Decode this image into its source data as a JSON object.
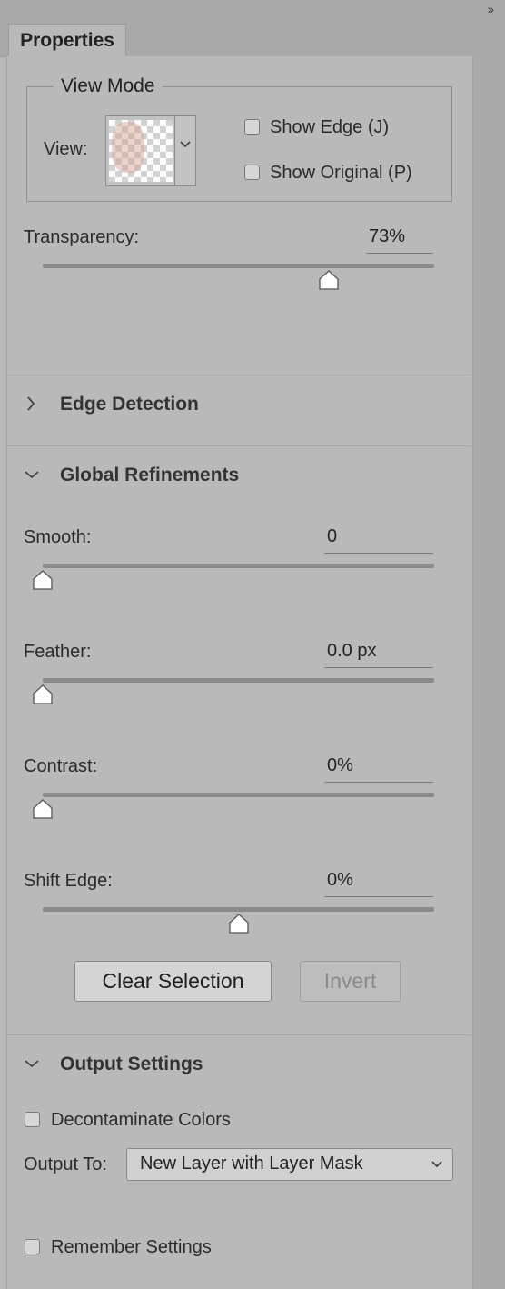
{
  "panel": {
    "collapse_icon": "double-chevron-right-icon",
    "tab_label": "Properties"
  },
  "view_mode": {
    "legend": "View Mode",
    "view_label": "View:",
    "show_edge_label": "Show Edge (J)",
    "show_edge_checked": false,
    "show_original_label": "Show Original (P)",
    "show_original_checked": false
  },
  "transparency": {
    "label": "Transparency:",
    "value": "73%",
    "level": 0.73
  },
  "edge_detection": {
    "title": "Edge Detection",
    "expanded": false
  },
  "global_refinements": {
    "title": "Global Refinements",
    "expanded": true,
    "smooth": {
      "label": "Smooth:",
      "value": "0",
      "level": 0
    },
    "feather": {
      "label": "Feather:",
      "value": "0.0 px",
      "level": 0
    },
    "contrast": {
      "label": "Contrast:",
      "value": "0%",
      "level": 0
    },
    "shift_edge": {
      "label": "Shift Edge:",
      "value": "0%",
      "level": 0.5
    },
    "clear_selection_label": "Clear Selection",
    "invert_label": "Invert"
  },
  "output_settings": {
    "title": "Output Settings",
    "expanded": true,
    "decontaminate_label": "Decontaminate Colors",
    "decontaminate_checked": false,
    "output_to_label": "Output To:",
    "output_to_value": "New Layer with Layer Mask"
  },
  "remember_settings": {
    "label": "Remember Settings",
    "checked": false
  },
  "colors": {
    "panel_bg": "#b9b9b9",
    "track": "#8a8a8a",
    "knob_fill": "#ffffff"
  }
}
